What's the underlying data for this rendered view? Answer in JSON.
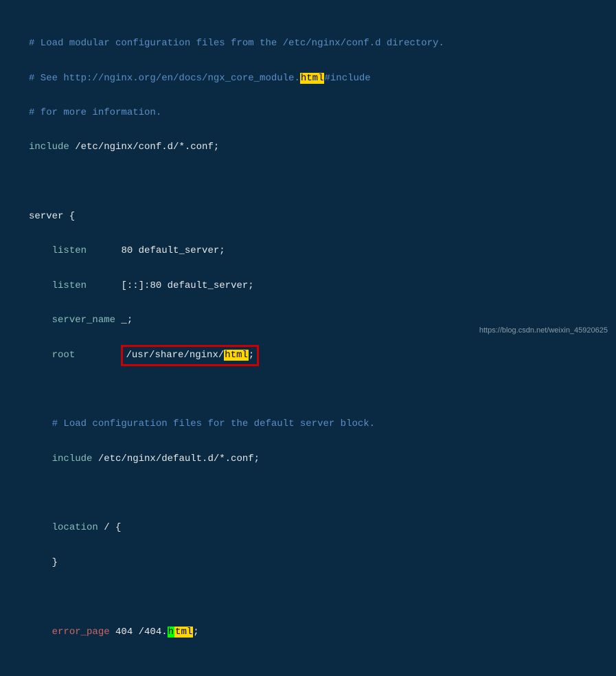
{
  "lines": {
    "comment1": "# Load modular configuration files from the /etc/nginx/conf.d directory.",
    "comment2_pre": "# See http://nginx.org/en/docs/ngx_core_module.",
    "comment2_hl": "html",
    "comment2_post": "#include",
    "comment3": "# for more information.",
    "include_kw": "include",
    "include_val": " /etc/nginx/conf.d/*.conf;",
    "server_open": "server {",
    "listen_kw": "listen",
    "listen1_val": "      80 default_server;",
    "listen2_val": "      [::]:80 default_server;",
    "servername_kw": "server_name",
    "servername_val": " _;",
    "root_kw": "root",
    "root_val_pre": "/usr/share/nginx/",
    "root_val_hl": "html",
    "root_val_post": ";",
    "comment4": "# Load configuration files for the default server block.",
    "include2_kw": "include",
    "include2_val": " /etc/nginx/default.d/*.conf;",
    "location_open_kw": "location",
    "location_open_val": " / {",
    "location_close": "}",
    "errorpage_kw": "error_page",
    "errorpage_val_pre": " 404 /404.",
    "errorpage_cursor": "h",
    "errorpage_hl": "tml",
    "errorpage_post": ";"
  },
  "watermark": "https://blog.csdn.net/weixin_45920625"
}
